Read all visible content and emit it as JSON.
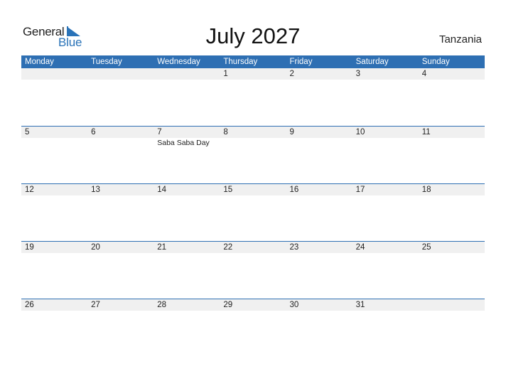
{
  "logo": {
    "general": "General",
    "blue": "Blue"
  },
  "title": "July 2027",
  "country": "Tanzania",
  "colors": {
    "accent": "#2e6fb3",
    "row_bg": "#f0f0f0"
  },
  "weekdays": [
    "Monday",
    "Tuesday",
    "Wednesday",
    "Thursday",
    "Friday",
    "Saturday",
    "Sunday"
  ],
  "weeks": [
    {
      "days": [
        "",
        "",
        "",
        "1",
        "2",
        "3",
        "4"
      ],
      "events": [
        "",
        "",
        "",
        "",
        "",
        "",
        ""
      ]
    },
    {
      "days": [
        "5",
        "6",
        "7",
        "8",
        "9",
        "10",
        "11"
      ],
      "events": [
        "",
        "",
        "Saba Saba Day",
        "",
        "",
        "",
        ""
      ]
    },
    {
      "days": [
        "12",
        "13",
        "14",
        "15",
        "16",
        "17",
        "18"
      ],
      "events": [
        "",
        "",
        "",
        "",
        "",
        "",
        ""
      ]
    },
    {
      "days": [
        "19",
        "20",
        "21",
        "22",
        "23",
        "24",
        "25"
      ],
      "events": [
        "",
        "",
        "",
        "",
        "",
        "",
        ""
      ]
    },
    {
      "days": [
        "26",
        "27",
        "28",
        "29",
        "30",
        "31",
        ""
      ],
      "events": [
        "",
        "",
        "",
        "",
        "",
        "",
        ""
      ]
    }
  ]
}
